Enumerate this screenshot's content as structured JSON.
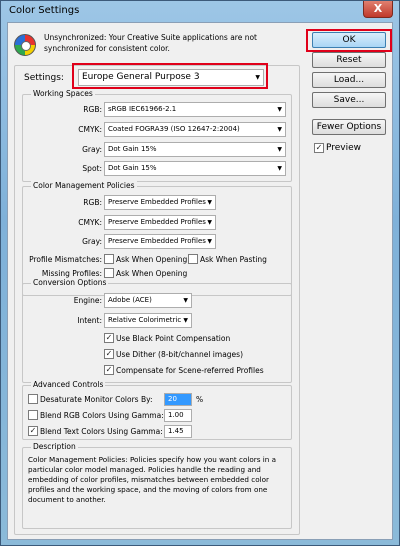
{
  "window": {
    "title": "Color Settings",
    "close_glyph": "X"
  },
  "header": {
    "message": "Unsynchronized: Your Creative Suite applications are not synchronized for consistent color.",
    "icon": "color-sync-icon"
  },
  "settings": {
    "label": "Settings:",
    "value": "Europe General Purpose 3"
  },
  "working_spaces": {
    "title": "Working Spaces",
    "rgb": {
      "label": "RGB:",
      "value": "sRGB IEC61966-2.1"
    },
    "cmyk": {
      "label": "CMYK:",
      "value": "Coated FOGRA39 (ISO 12647-2:2004)"
    },
    "gray": {
      "label": "Gray:",
      "value": "Dot Gain 15%"
    },
    "spot": {
      "label": "Spot:",
      "value": "Dot Gain 15%"
    }
  },
  "policies": {
    "title": "Color Management Policies",
    "rgb": {
      "label": "RGB:",
      "value": "Preserve Embedded Profiles"
    },
    "cmyk": {
      "label": "CMYK:",
      "value": "Preserve Embedded Profiles"
    },
    "gray": {
      "label": "Gray:",
      "value": "Preserve Embedded Profiles"
    },
    "mismatches_label": "Profile Mismatches:",
    "missing_label": "Missing Profiles:",
    "ask_opening": "Ask When Opening",
    "ask_pasting": "Ask When Pasting",
    "missing_ask_opening": "Ask When Opening"
  },
  "conversion": {
    "title": "Conversion Options",
    "engine": {
      "label": "Engine:",
      "value": "Adobe (ACE)"
    },
    "intent": {
      "label": "Intent:",
      "value": "Relative Colorimetric"
    },
    "bpc": "Use Black Point Compensation",
    "dither": "Use Dither (8-bit/channel images)",
    "compensate": "Compensate for Scene-referred Profiles"
  },
  "advanced": {
    "title": "Advanced Controls",
    "desaturate": {
      "label": "Desaturate Monitor Colors By:",
      "value": "20",
      "unit": "%"
    },
    "blend_rgb": {
      "label": "Blend RGB Colors Using Gamma:",
      "value": "1.00"
    },
    "blend_text": {
      "label": "Blend Text Colors Using Gamma:",
      "value": "1.45"
    }
  },
  "description": {
    "title": "Description",
    "text": "Color Management Policies:  Policies specify how you want colors in a particular color model managed.  Policies handle the reading and embedding of color profiles, mismatches between embedded color profiles and the working space, and the moving of colors from one document to another."
  },
  "buttons": {
    "ok": "OK",
    "reset": "Reset",
    "load": "Load...",
    "save": "Save...",
    "fewer": "Fewer Options",
    "preview": "Preview"
  },
  "check_glyph": "✓",
  "arrow_glyph": "▼",
  "colors": {
    "highlight": "#e0001a",
    "panel": "#f0f0f0",
    "title_bar": "#9dc6e6"
  }
}
